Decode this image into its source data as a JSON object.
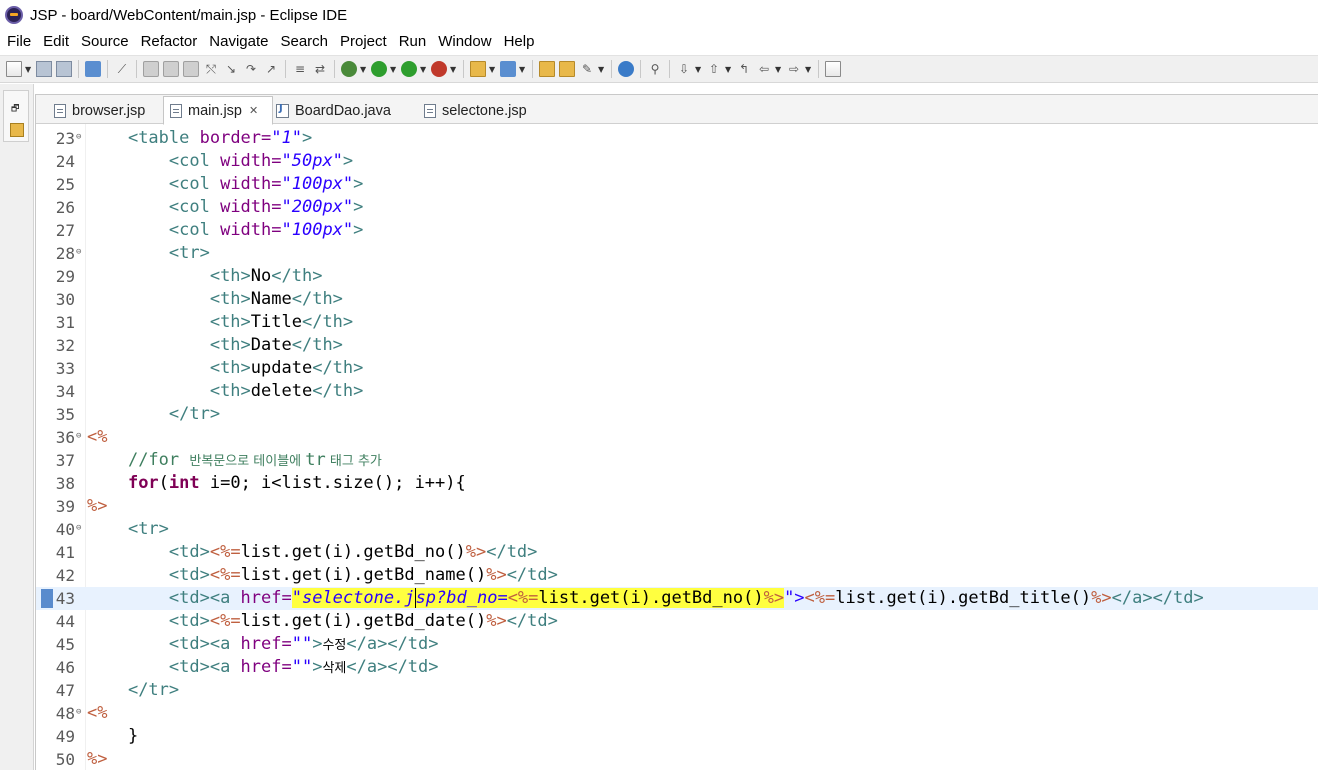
{
  "window": {
    "title": "JSP - board/WebContent/main.jsp - Eclipse IDE"
  },
  "menu": [
    "File",
    "Edit",
    "Source",
    "Refactor",
    "Navigate",
    "Search",
    "Project",
    "Run",
    "Window",
    "Help"
  ],
  "tabs": [
    {
      "label": "browser.jsp",
      "type": "jsp",
      "active": false
    },
    {
      "label": "main.jsp",
      "type": "jsp",
      "active": true
    },
    {
      "label": "BoardDao.java",
      "type": "java",
      "active": false
    },
    {
      "label": "selectone.jsp",
      "type": "jsp",
      "active": false
    }
  ],
  "editor": {
    "current_line": 43,
    "lines": [
      {
        "n": "23",
        "fold": true,
        "tokens": [
          [
            "    ",
            ""
          ],
          [
            "<table ",
            "tag"
          ],
          [
            "border=",
            "attr"
          ],
          [
            "\"1\"",
            "str"
          ],
          [
            ">",
            "tag"
          ]
        ]
      },
      {
        "n": "24",
        "tokens": [
          [
            "        ",
            ""
          ],
          [
            "<col ",
            "tag"
          ],
          [
            "width=",
            "attr"
          ],
          [
            "\"50px\"",
            "str"
          ],
          [
            ">",
            "tag"
          ]
        ]
      },
      {
        "n": "25",
        "tokens": [
          [
            "        ",
            ""
          ],
          [
            "<col ",
            "tag"
          ],
          [
            "width=",
            "attr"
          ],
          [
            "\"100px\"",
            "str"
          ],
          [
            ">",
            "tag"
          ]
        ]
      },
      {
        "n": "26",
        "tokens": [
          [
            "        ",
            ""
          ],
          [
            "<col ",
            "tag"
          ],
          [
            "width=",
            "attr"
          ],
          [
            "\"200px\"",
            "str"
          ],
          [
            ">",
            "tag"
          ]
        ]
      },
      {
        "n": "27",
        "tokens": [
          [
            "        ",
            ""
          ],
          [
            "<col ",
            "tag"
          ],
          [
            "width=",
            "attr"
          ],
          [
            "\"100px\"",
            "str"
          ],
          [
            ">",
            "tag"
          ]
        ]
      },
      {
        "n": "28",
        "fold": true,
        "tokens": [
          [
            "        ",
            ""
          ],
          [
            "<tr>",
            "tag"
          ]
        ]
      },
      {
        "n": "29",
        "tokens": [
          [
            "            ",
            ""
          ],
          [
            "<th>",
            "tag"
          ],
          [
            "No",
            ""
          ],
          [
            "</th>",
            "tag"
          ]
        ]
      },
      {
        "n": "30",
        "tokens": [
          [
            "            ",
            ""
          ],
          [
            "<th>",
            "tag"
          ],
          [
            "Name",
            ""
          ],
          [
            "</th>",
            "tag"
          ]
        ]
      },
      {
        "n": "31",
        "tokens": [
          [
            "            ",
            ""
          ],
          [
            "<th>",
            "tag"
          ],
          [
            "Title",
            ""
          ],
          [
            "</th>",
            "tag"
          ]
        ]
      },
      {
        "n": "32",
        "tokens": [
          [
            "            ",
            ""
          ],
          [
            "<th>",
            "tag"
          ],
          [
            "Date",
            ""
          ],
          [
            "</th>",
            "tag"
          ]
        ]
      },
      {
        "n": "33",
        "tokens": [
          [
            "            ",
            ""
          ],
          [
            "<th>",
            "tag"
          ],
          [
            "update",
            ""
          ],
          [
            "</th>",
            "tag"
          ]
        ]
      },
      {
        "n": "34",
        "tokens": [
          [
            "            ",
            ""
          ],
          [
            "<th>",
            "tag"
          ],
          [
            "delete",
            ""
          ],
          [
            "</th>",
            "tag"
          ]
        ]
      },
      {
        "n": "35",
        "tokens": [
          [
            "        ",
            ""
          ],
          [
            "</tr>",
            "tag"
          ]
        ]
      },
      {
        "n": "36",
        "fold": true,
        "tokens": [
          [
            "<%",
            "jsp"
          ]
        ]
      },
      {
        "n": "37",
        "tokens": [
          [
            "    ",
            ""
          ],
          [
            "//for ",
            "cmt"
          ],
          [
            "반복문으로 테이블에 ",
            "cmt kor"
          ],
          [
            "tr",
            "cmt"
          ],
          [
            " 태그 추가",
            "cmt kor"
          ]
        ]
      },
      {
        "n": "38",
        "tokens": [
          [
            "    ",
            ""
          ],
          [
            "for",
            "kw"
          ],
          [
            "(",
            ""
          ],
          [
            "int",
            "kw"
          ],
          [
            " i=0; i<list.size(); i++){",
            ""
          ]
        ]
      },
      {
        "n": "39",
        "tokens": [
          [
            "%>",
            "jsp"
          ]
        ]
      },
      {
        "n": "40",
        "fold": true,
        "tokens": [
          [
            "    ",
            ""
          ],
          [
            "<tr>",
            "tag"
          ]
        ]
      },
      {
        "n": "41",
        "tokens": [
          [
            "        ",
            ""
          ],
          [
            "<td>",
            "tag"
          ],
          [
            "<%=",
            "jsp"
          ],
          [
            "list.get(i).getBd_no()",
            ""
          ],
          [
            "%>",
            "jsp"
          ],
          [
            "</td>",
            "tag"
          ]
        ]
      },
      {
        "n": "42",
        "tokens": [
          [
            "        ",
            ""
          ],
          [
            "<td>",
            "tag"
          ],
          [
            "<%=",
            "jsp"
          ],
          [
            "list.get(i).getBd_name()",
            ""
          ],
          [
            "%>",
            "jsp"
          ],
          [
            "</td>",
            "tag"
          ]
        ]
      },
      {
        "n": "43",
        "tokens": [
          [
            "        ",
            ""
          ],
          [
            "<td><a ",
            "tag"
          ],
          [
            "href=",
            "attr"
          ],
          [
            "\"selectone.j",
            "str hl"
          ],
          [
            "sp?bd_no=",
            "str hl caret"
          ],
          [
            "<%=",
            "jsp hl"
          ],
          [
            "list.get(i).getBd_no()",
            "hl"
          ],
          [
            "%>",
            "jsp hl"
          ],
          [
            "\">",
            "str"
          ],
          [
            "<%=",
            "jsp"
          ],
          [
            "list.get(i).getBd_title()",
            ""
          ],
          [
            "%>",
            "jsp"
          ],
          [
            "</a></td>",
            "tag"
          ]
        ]
      },
      {
        "n": "44",
        "tokens": [
          [
            "        ",
            ""
          ],
          [
            "<td>",
            "tag"
          ],
          [
            "<%=",
            "jsp"
          ],
          [
            "list.get(i).getBd_date()",
            ""
          ],
          [
            "%>",
            "jsp"
          ],
          [
            "</td>",
            "tag"
          ]
        ]
      },
      {
        "n": "45",
        "tokens": [
          [
            "        ",
            ""
          ],
          [
            "<td><a ",
            "tag"
          ],
          [
            "href=",
            "attr"
          ],
          [
            "\"\"",
            "str"
          ],
          [
            ">",
            "tag"
          ],
          [
            "수정",
            "kor"
          ],
          [
            "</a></td>",
            "tag"
          ]
        ]
      },
      {
        "n": "46",
        "tokens": [
          [
            "        ",
            ""
          ],
          [
            "<td><a ",
            "tag"
          ],
          [
            "href=",
            "attr"
          ],
          [
            "\"\"",
            "str"
          ],
          [
            ">",
            "tag"
          ],
          [
            "삭제",
            "kor"
          ],
          [
            "</a></td>",
            "tag"
          ]
        ]
      },
      {
        "n": "47",
        "tokens": [
          [
            "    ",
            ""
          ],
          [
            "</tr>",
            "tag"
          ]
        ]
      },
      {
        "n": "48",
        "fold": true,
        "tokens": [
          [
            "<%",
            "jsp"
          ]
        ]
      },
      {
        "n": "49",
        "tokens": [
          [
            "    }",
            ""
          ]
        ]
      },
      {
        "n": "50",
        "tokens": [
          [
            "%>",
            "jsp"
          ]
        ]
      }
    ]
  }
}
